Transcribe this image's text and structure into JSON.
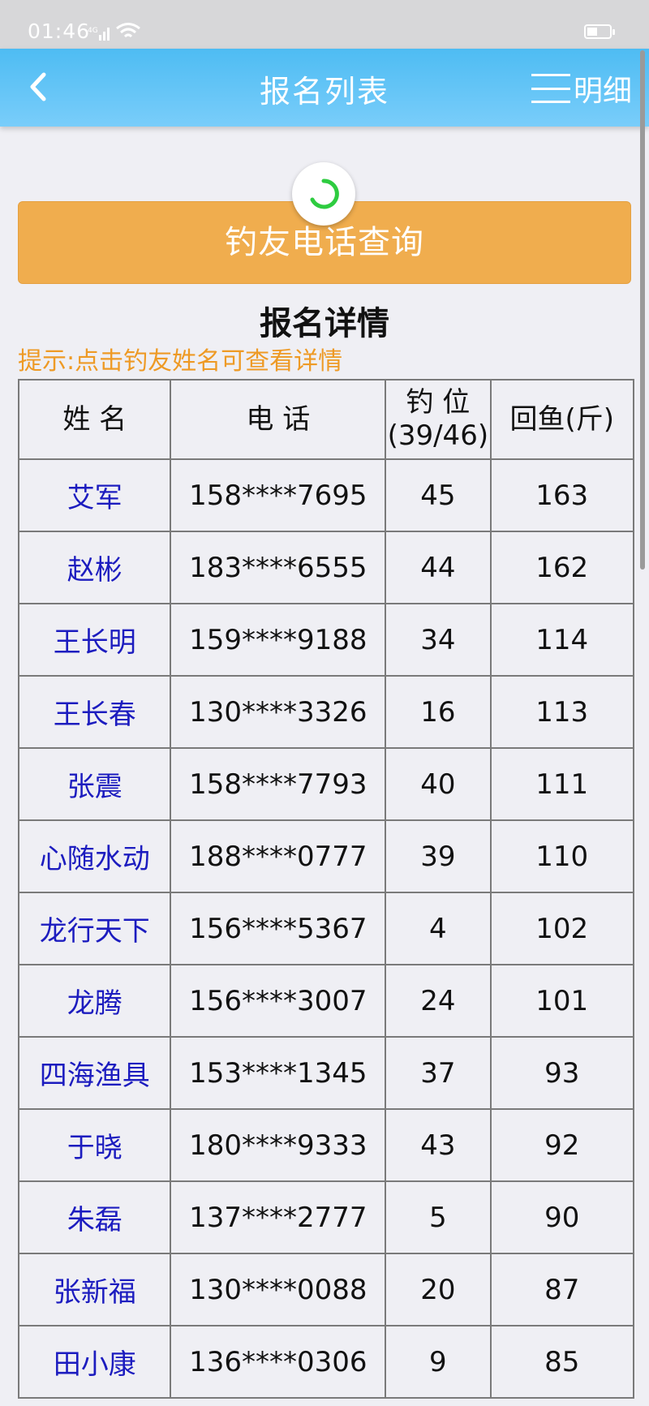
{
  "status_bar": {
    "time": "01:46",
    "network": "4G"
  },
  "nav": {
    "title": "报名列表",
    "menu_label": "明细"
  },
  "query_button": "钓友电话查询",
  "section_title": "报名详情",
  "hint": "提示:点击钓友姓名可查看详情",
  "table": {
    "headers": {
      "name": "姓 名",
      "phone": "电 话",
      "seat": "钓 位",
      "seat_count": "(39/46)",
      "fish": "回鱼(斤)"
    },
    "rows": [
      {
        "name": "艾军",
        "phone": "158****7695",
        "seat": "45",
        "fish": "163"
      },
      {
        "name": "赵彬",
        "phone": "183****6555",
        "seat": "44",
        "fish": "162"
      },
      {
        "name": "王长明",
        "phone": "159****9188",
        "seat": "34",
        "fish": "114"
      },
      {
        "name": "王长春",
        "phone": "130****3326",
        "seat": "16",
        "fish": "113"
      },
      {
        "name": "张震",
        "phone": "158****7793",
        "seat": "40",
        "fish": "111"
      },
      {
        "name": "心随水动",
        "phone": "188****0777",
        "seat": "39",
        "fish": "110"
      },
      {
        "name": "龙行天下",
        "phone": "156****5367",
        "seat": "4",
        "fish": "102"
      },
      {
        "name": "龙腾",
        "phone": "156****3007",
        "seat": "24",
        "fish": "101"
      },
      {
        "name": "四海渔具",
        "phone": "153****1345",
        "seat": "37",
        "fish": "93"
      },
      {
        "name": "于晓",
        "phone": "180****9333",
        "seat": "43",
        "fish": "92"
      },
      {
        "name": "朱磊",
        "phone": "137****2777",
        "seat": "5",
        "fish": "90"
      },
      {
        "name": "张新福",
        "phone": "130****0088",
        "seat": "20",
        "fish": "87"
      },
      {
        "name": "田小康",
        "phone": "136****0306",
        "seat": "9",
        "fish": "85"
      }
    ]
  },
  "colors": {
    "nav": "#4ebcf3",
    "button": "#f0ad4e",
    "hint": "#ee9a25",
    "name_link": "#1c1cbf",
    "spinner": "#2ecc40"
  }
}
